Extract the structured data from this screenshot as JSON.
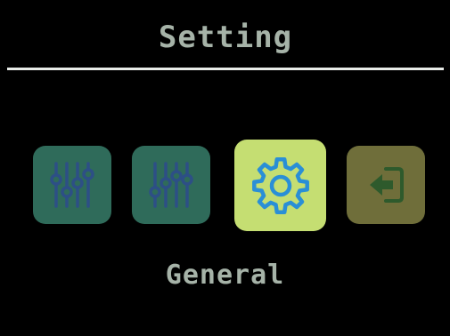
{
  "screen": {
    "title": "Setting",
    "selected_label": "General"
  },
  "menu": {
    "items": [
      {
        "icon": "sliders-icon",
        "state": "dim",
        "bg": "#2f6b5a",
        "fg": "#2d4f86"
      },
      {
        "icon": "sliders-icon",
        "state": "dim",
        "bg": "#2f6b5a",
        "fg": "#2d4f86"
      },
      {
        "icon": "gear-icon",
        "state": "selected",
        "bg": "#c5de72",
        "fg": "#2a8fd6"
      },
      {
        "icon": "exit-icon",
        "state": "dim",
        "bg": "#6f6e3a",
        "fg": "#2e5a2c"
      }
    ]
  },
  "colors": {
    "background": "#000000",
    "text": "#a6b3a8",
    "divider": "#e8ece8"
  }
}
